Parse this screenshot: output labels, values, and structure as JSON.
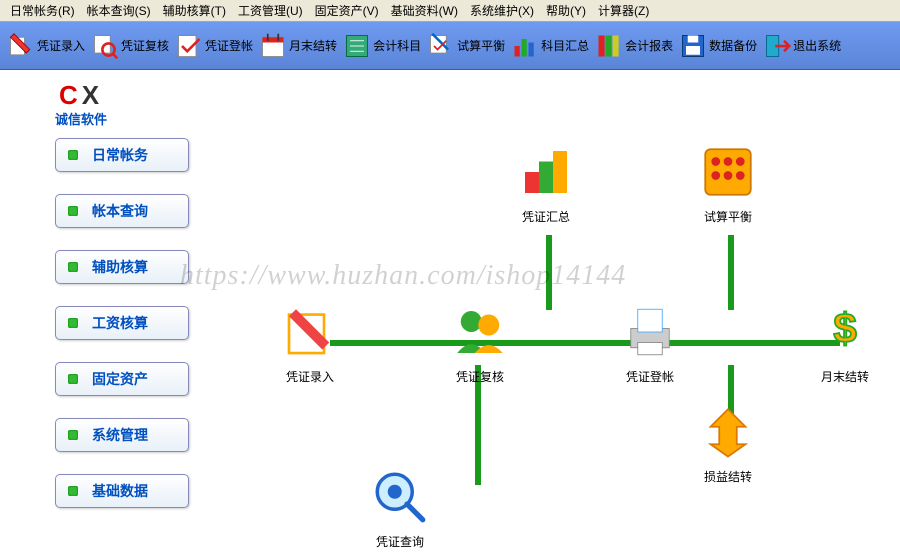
{
  "menubar": [
    "日常帐务(R)",
    "帐本查询(S)",
    "辅助核算(T)",
    "工资管理(U)",
    "固定资产(V)",
    "基础资料(W)",
    "系统维护(X)",
    "帮助(Y)",
    "计算器(Z)"
  ],
  "toolbar": [
    {
      "label": "凭证录入"
    },
    {
      "label": "凭证复核"
    },
    {
      "label": "凭证登帐"
    },
    {
      "label": "月末结转"
    },
    {
      "label": "会计科目"
    },
    {
      "label": "试算平衡"
    },
    {
      "label": "科目汇总"
    },
    {
      "label": "会计报表"
    },
    {
      "label": "数据备份"
    },
    {
      "label": "退出系统"
    }
  ],
  "logo": {
    "cx": "CX",
    "sub": "诚信软件"
  },
  "sidebar": [
    "日常帐务",
    "帐本查询",
    "辅助核算",
    "工资核算",
    "固定资产",
    "系统管理",
    "基础数据"
  ],
  "workflow": {
    "summary": "凭证汇总",
    "trial": "试算平衡",
    "entry": "凭证录入",
    "review": "凭证复核",
    "post": "凭证登帐",
    "monthend": "月末结转",
    "profit": "损益结转",
    "query": "凭证查询"
  },
  "watermark": "https://www.huzhan.com/ishop14144"
}
